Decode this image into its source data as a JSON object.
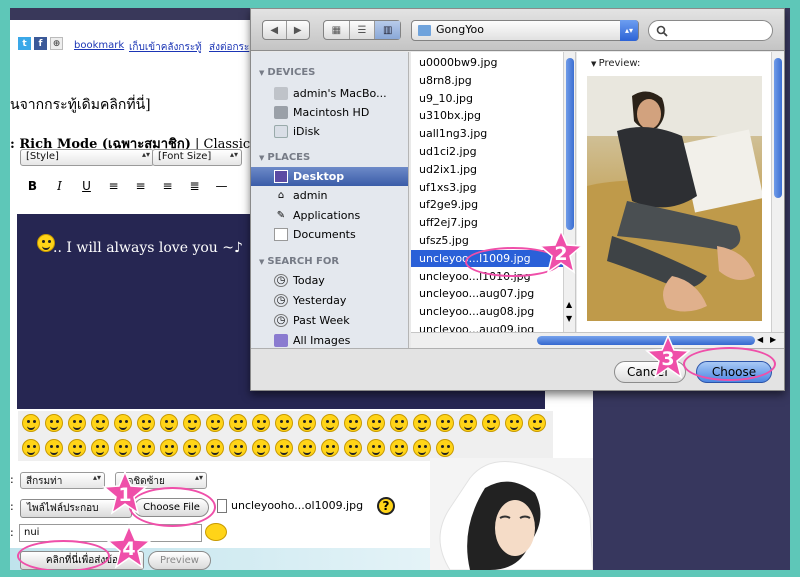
{
  "web_page": {
    "links": [
      "bookmark",
      "เก็บเข้าคลังกระทู้",
      "ส่งต่อกระ"
    ],
    "thread_title": "ันจากกระทู้เดิมคลิกที่นี่]",
    "mode_line": {
      "prefix": ": ",
      "rich_mode": "Rich Mode (เฉพาะสมาชิก)",
      "separator": " | ",
      "classic": "Classic"
    },
    "style_select": "[Style]",
    "font_size_select": "[Font Size]",
    "editor_text": ".. I will always love you ~♪",
    "prefix_colon": ":",
    "select_gallery": "สีกรมท่า",
    "select_align": "จัดชิดซ้าย",
    "file_field_label": "ไพล์ไฟล์ประกอบ",
    "choose_file_button": "Choose File",
    "chosen_file_name": "uncleyooho...ol1009.jpg",
    "help_icon_text": "?",
    "name_input_value": "nui",
    "submit_button": "คลิกที่นี่เพื่อส่งข้อ",
    "preview_button": "Preview"
  },
  "dialog": {
    "location": "GongYoo",
    "devices_header": "DEVICES",
    "devices": [
      "admin's MacBo...",
      "Macintosh HD",
      "iDisk"
    ],
    "places_header": "PLACES",
    "places": [
      "Desktop",
      "admin",
      "Applications",
      "Documents"
    ],
    "selected_place": "Desktop",
    "search_header": "SEARCH FOR",
    "searches": [
      "Today",
      "Yesterday",
      "Past Week",
      "All Images"
    ],
    "files": [
      "u0000bw9.jpg",
      "u8rn8.jpg",
      "u9_10.jpg",
      "u310bx.jpg",
      "uall1ng3.jpg",
      "ud1ci2.jpg",
      "ud2ix1.jpg",
      "uf1xs3.jpg",
      "uf2ge9.jpg",
      "uff2ej7.jpg",
      "ufsz5.jpg",
      "uncleyoo...l1009.jpg",
      "uncleyoo...l1010.jpg",
      "uncleyoo...aug07.jpg",
      "uncleyoo...aug08.jpg",
      "uncleyoo...aug09.jpg"
    ],
    "selected_file": "uncleyoo...l1009.jpg",
    "preview_label": "Preview:",
    "cancel_button": "Cancel",
    "choose_button": "Choose"
  },
  "annotations": {
    "step_1": "1",
    "step_2": "2",
    "step_3": "3",
    "step_4": "4",
    "color": "#ef4fa9"
  },
  "colors": {
    "page_border": "#5ec7b8",
    "editor_bg": "#262652",
    "selection_blue": "#2a60d8",
    "aqua_button": "#4c86e3"
  }
}
